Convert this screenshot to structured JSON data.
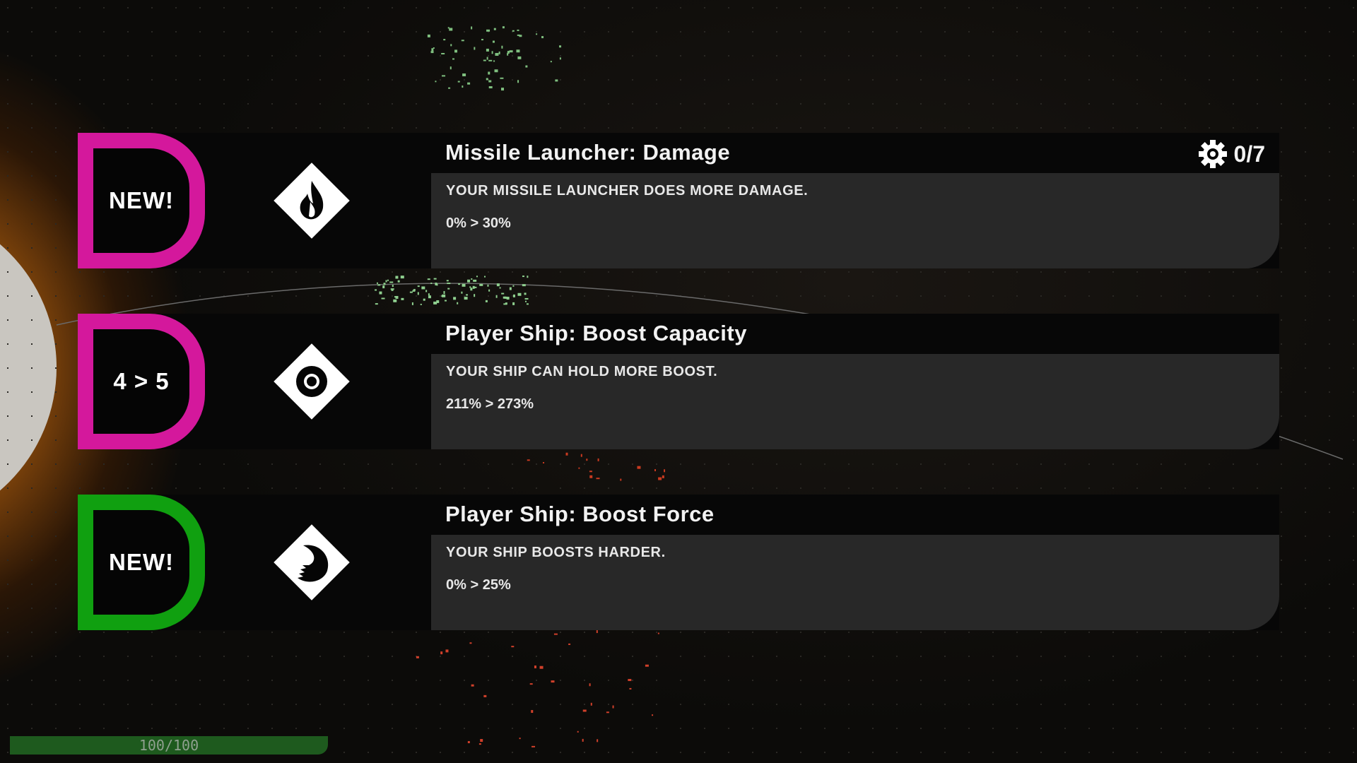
{
  "colors": {
    "tier_new": "#d4189c",
    "tier_upgrade": "#d4189c",
    "tier_new_green": "#10a010"
  },
  "upgrade_counter": {
    "icon": "gear-icon",
    "value": "0/7"
  },
  "upgrades": [
    {
      "tier_label": "NEW!",
      "tier_color": "#d4189c",
      "icon": "flame-icon",
      "title": "Missile Launcher: Damage",
      "description": "YOUR MISSILE LAUNCHER DOES MORE DAMAGE.",
      "stat": "0% > 30%"
    },
    {
      "tier_label": "4 > 5",
      "tier_color": "#d4189c",
      "icon": "ring-icon",
      "title": "Player Ship: Boost Capacity",
      "description": "YOUR SHIP CAN HOLD MORE BOOST.",
      "stat": "211% > 273%"
    },
    {
      "tier_label": "NEW!",
      "tier_color": "#10a010",
      "icon": "crescent-icon",
      "title": "Player Ship: Boost Force",
      "description": "YOUR SHIP BOOSTS HARDER.",
      "stat": "0% > 25%"
    }
  ],
  "health": {
    "text": "100/100",
    "fraction": 1.0
  }
}
